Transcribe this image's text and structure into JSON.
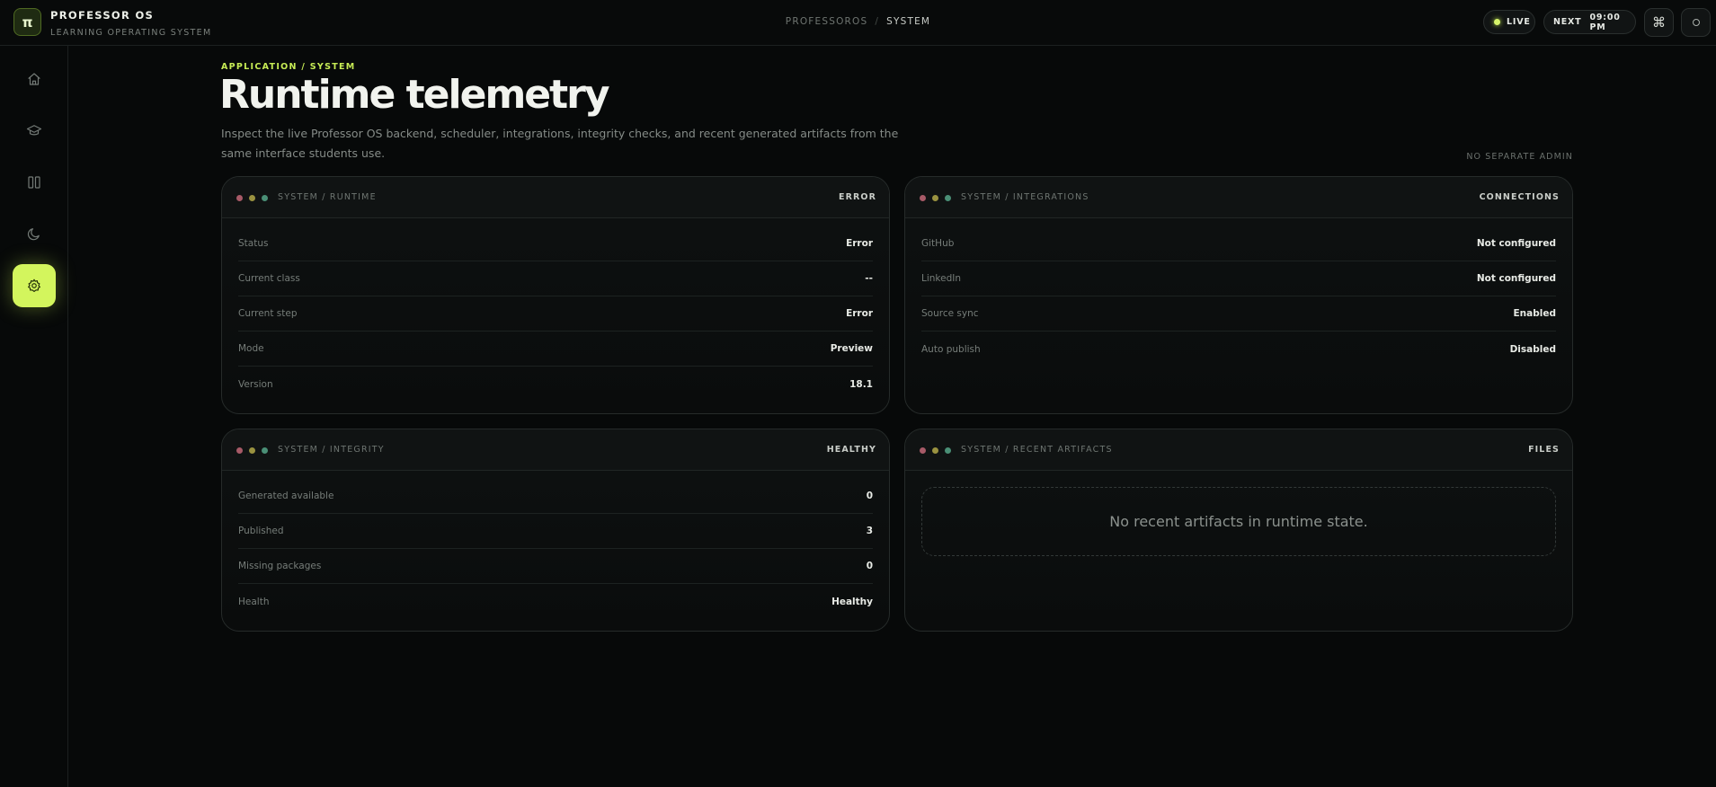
{
  "app": {
    "logo_glyph": "π",
    "title": "PROFESSOR OS",
    "subtitle": "LEARNING OPERATING SYSTEM"
  },
  "breadcrumb": {
    "root": "PROFESSOROS",
    "separator": "/",
    "current": "SYSTEM"
  },
  "topbar": {
    "live_label": "LIVE",
    "next_label": "NEXT",
    "next_time": "09:00 PM",
    "command_icon": "⌘"
  },
  "sidebar": {
    "items": [
      {
        "name": "home-icon",
        "active": false
      },
      {
        "name": "graduation-cap-icon",
        "active": false
      },
      {
        "name": "book-icon",
        "active": false
      },
      {
        "name": "moon-icon",
        "active": false
      },
      {
        "name": "gear-icon",
        "active": true
      }
    ],
    "footer_icon": "code-icon"
  },
  "header": {
    "eyebrow": "APPLICATION / SYSTEM",
    "title": "Runtime telemetry",
    "description": "Inspect the live Professor OS backend, scheduler, integrations, integrity checks, and recent generated artifacts from the same interface students use.",
    "admin_note": "NO SEPARATE ADMIN"
  },
  "panels": {
    "runtime": {
      "title": "SYSTEM / RUNTIME",
      "tag": "ERROR",
      "rows": [
        {
          "label": "Status",
          "value": "Error"
        },
        {
          "label": "Current class",
          "value": "--"
        },
        {
          "label": "Current step",
          "value": "Error"
        },
        {
          "label": "Mode",
          "value": "Preview"
        },
        {
          "label": "Version",
          "value": "18.1"
        }
      ]
    },
    "integrations": {
      "title": "SYSTEM / INTEGRATIONS",
      "tag": "CONNECTIONS",
      "rows": [
        {
          "label": "GitHub",
          "value": "Not configured"
        },
        {
          "label": "LinkedIn",
          "value": "Not configured"
        },
        {
          "label": "Source sync",
          "value": "Enabled"
        },
        {
          "label": "Auto publish",
          "value": "Disabled"
        }
      ]
    },
    "integrity": {
      "title": "SYSTEM / INTEGRITY",
      "tag": "HEALTHY",
      "rows": [
        {
          "label": "Generated available",
          "value": "0"
        },
        {
          "label": "Published",
          "value": "3"
        },
        {
          "label": "Missing packages",
          "value": "0"
        },
        {
          "label": "Health",
          "value": "Healthy"
        }
      ]
    },
    "artifacts": {
      "title": "SYSTEM / RECENT ARTIFACTS",
      "tag": "FILES",
      "empty_message": "No recent artifacts in runtime state."
    }
  },
  "colors": {
    "accent": "#d3f55d",
    "background": "#070909",
    "dot_red": "#a75a67",
    "dot_yellow": "#9a9240",
    "dot_green": "#4a8f76"
  }
}
